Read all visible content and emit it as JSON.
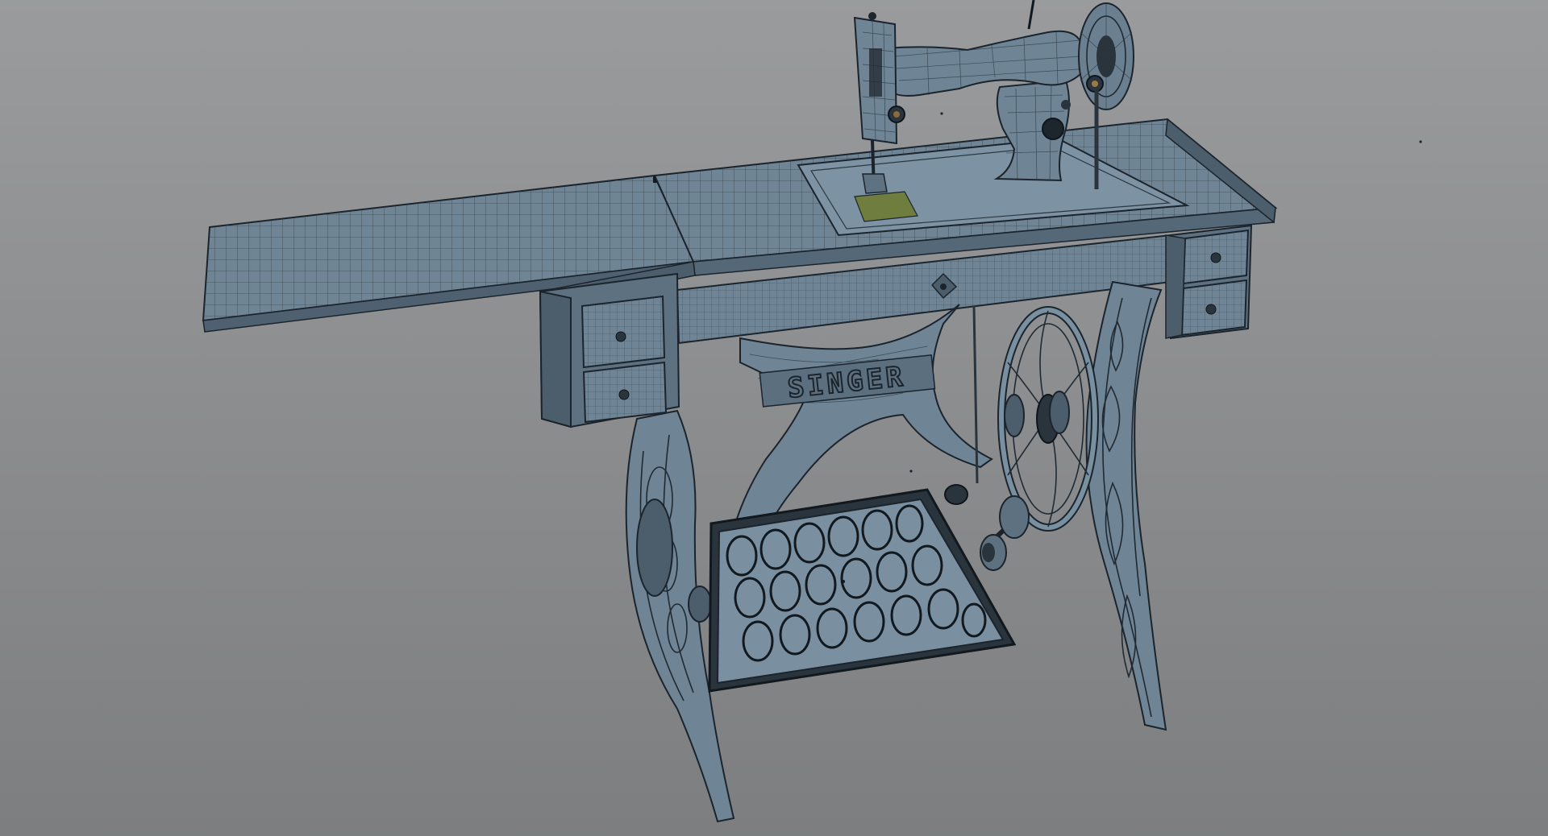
{
  "viewport": {
    "background_top": "#9a9b9d",
    "background_bottom": "#7d7e80",
    "mesh_fill": "#6f8494",
    "wire_color": "#1f2a33"
  },
  "model": {
    "base_lettering": "SINGER"
  }
}
